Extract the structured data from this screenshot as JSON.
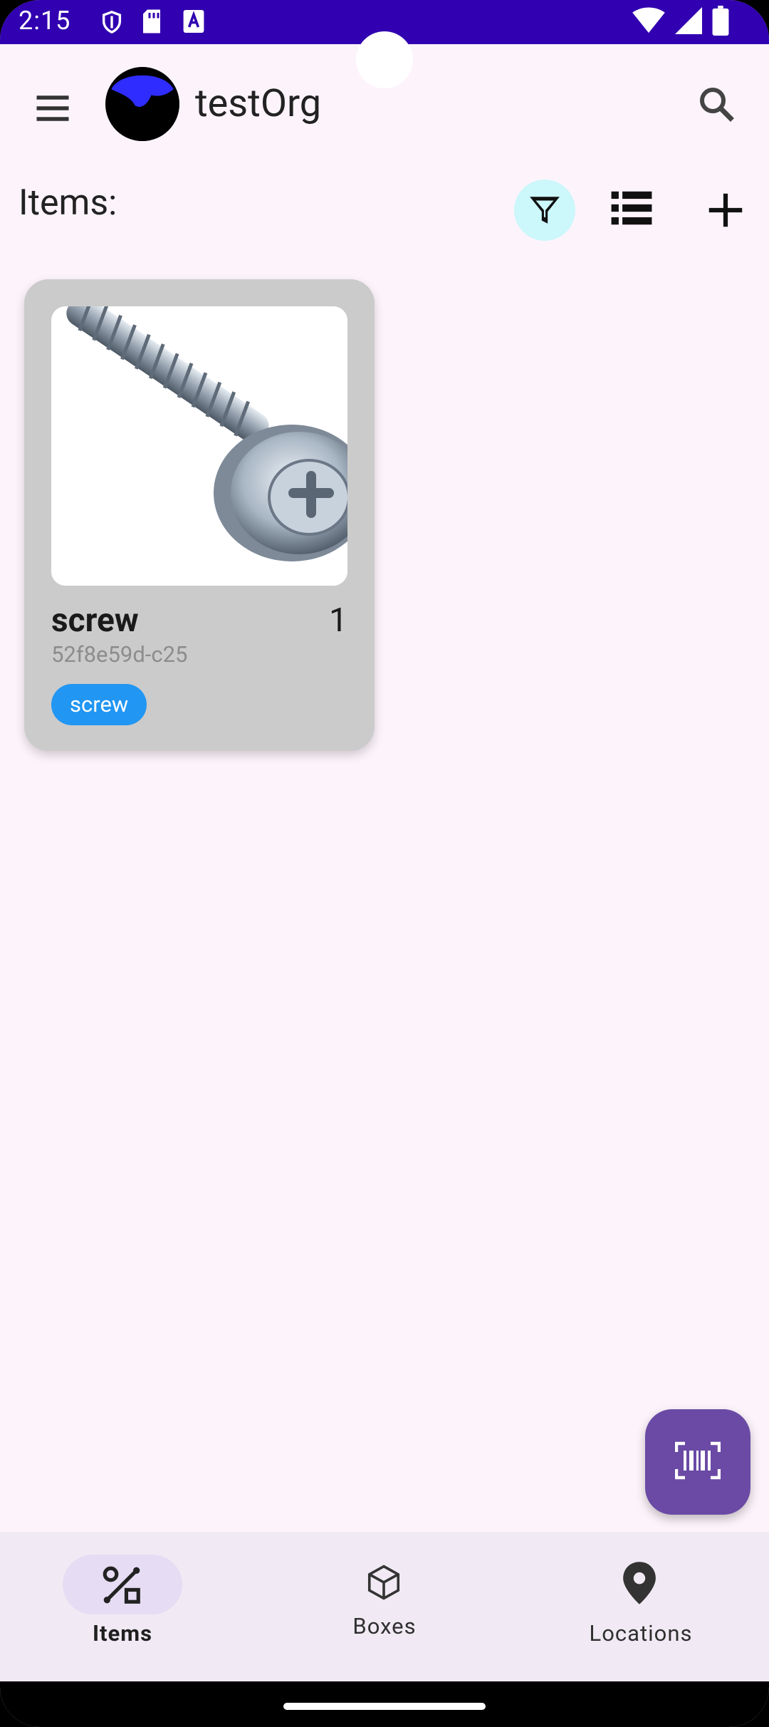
{
  "statusbar": {
    "time": "2:15",
    "icons": [
      "shield-icon",
      "sd-card-icon",
      "a-badge-icon",
      "wifi-icon",
      "signal-icon",
      "battery-icon"
    ]
  },
  "appbar": {
    "org_name": "testOrg",
    "icons": [
      "menu-icon",
      "org-avatar",
      "search-icon"
    ]
  },
  "toolbar": {
    "label": "Items:",
    "icons": [
      "filter-icon",
      "list-view-icon",
      "add-icon"
    ],
    "filter_active_color": "#ccf7fb"
  },
  "items": [
    {
      "name": "screw",
      "quantity": "1",
      "id": "52f8e59d-c25",
      "tag": "screw",
      "image": "screw-photo"
    }
  ],
  "fab": {
    "icon": "barcode-scan-icon",
    "color": "#6a4aa5"
  },
  "bottom_nav": [
    {
      "label": "Items",
      "icon": "items-icon",
      "active": true
    },
    {
      "label": "Boxes",
      "icon": "box-icon",
      "active": false
    },
    {
      "label": "Locations",
      "icon": "location-pin-icon",
      "active": false
    }
  ],
  "colors": {
    "statusbar": "#3100b0",
    "background": "#fdf4fb",
    "tag": "#2196f3",
    "nav": "#f1eaf4"
  }
}
